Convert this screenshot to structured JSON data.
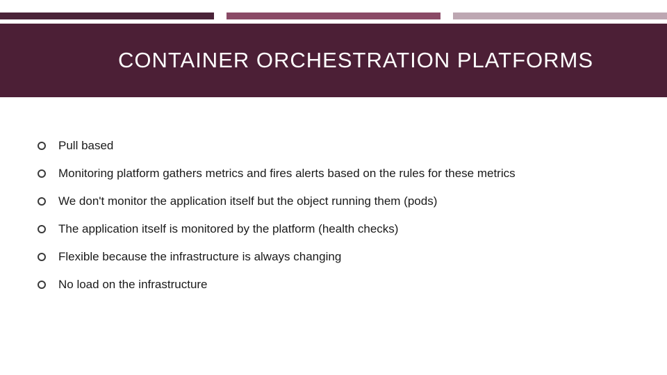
{
  "title": "CONTAINER ORCHESTRATION PLATFORMS",
  "bullets": [
    "Pull based",
    "Monitoring platform gathers metrics and fires alerts based on the rules for these metrics",
    "We don't monitor the application itself but the object running them (pods)",
    "The application itself is monitored by the platform (health checks)",
    "Flexible because the infrastructure is always changing",
    "No load on the infrastructure"
  ]
}
